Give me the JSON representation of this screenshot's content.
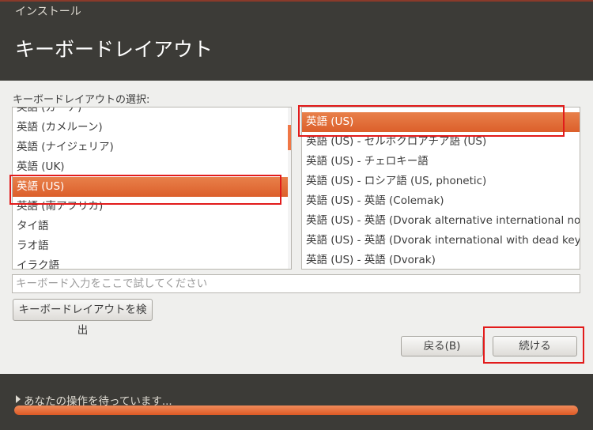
{
  "window": {
    "title": "インストール"
  },
  "header": {
    "title": "キーボードレイアウト"
  },
  "layout_selection": {
    "label": "キーボードレイアウトの選択:",
    "layouts": [
      "英語 (ガーナ)",
      "英語 (カメルーン)",
      "英語 (ナイジェリア)",
      "英語 (UK)",
      "英語 (US)",
      "英語 (南アフリカ)",
      "タイ語",
      "ラオ語",
      "イラク語"
    ],
    "selected_layout": "英語 (US)",
    "variants": [
      "英語 (US)",
      "英語 (US) - セルボクロアチア語 (US)",
      "英語 (US) - チェロキー語",
      "英語 (US) - ロシア語 (US, phonetic)",
      "英語 (US) - 英語 (Colemak)",
      "英語 (US) - 英語 (Dvorak alternative international no",
      "英語 (US) - 英語 (Dvorak international with dead keys",
      "英語 (US) - 英語 (Dvorak)"
    ],
    "selected_variant": "英語 (US)",
    "layouts_scroll_fraction": 0.36,
    "variants_scroll_fraction": 0.0
  },
  "test_field": {
    "placeholder": "キーボード入力をここで試してください",
    "value": ""
  },
  "buttons": {
    "detect": "キーボードレイアウトを検出",
    "back": "戻る(B)",
    "continue": "続ける"
  },
  "footer": {
    "status": "あなたの操作を待っています...",
    "progress": 1.0
  },
  "colors": {
    "accent": "#dd5a25",
    "header_bg": "#3c3b37",
    "body_bg": "#efefed",
    "annotation": "#e21b1b"
  },
  "icons": {
    "expander": "triangle-right-icon"
  }
}
